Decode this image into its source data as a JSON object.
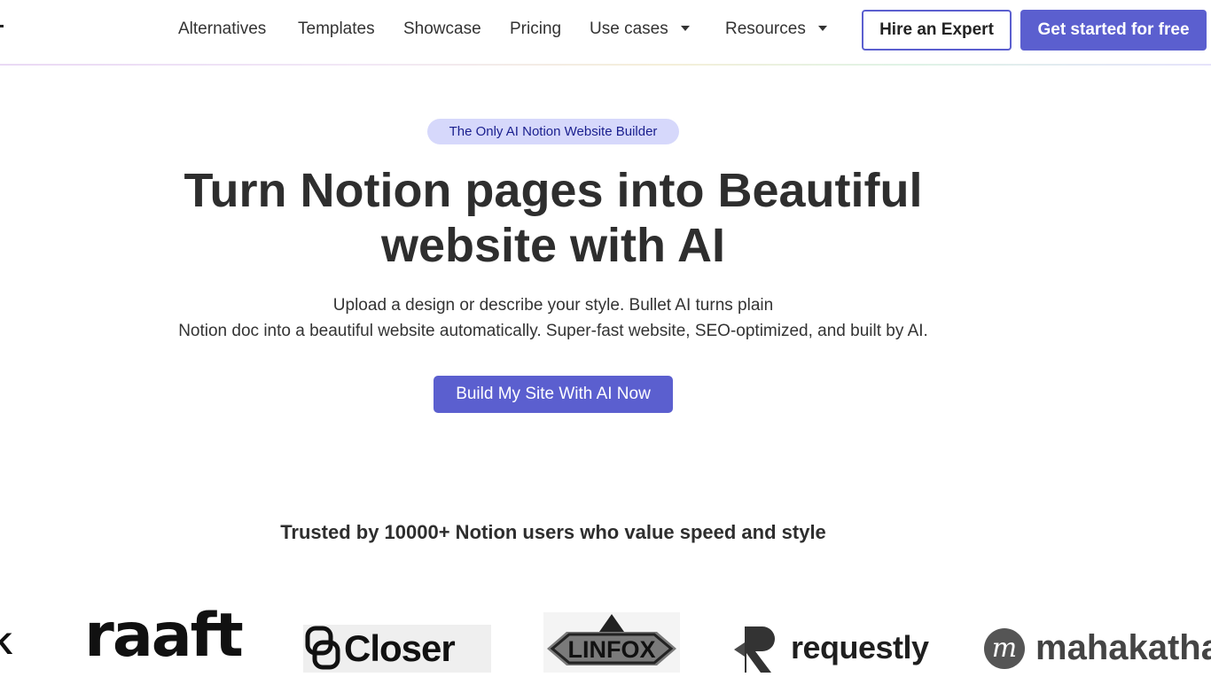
{
  "nav": {
    "links": [
      {
        "label": "Alternatives"
      },
      {
        "label": "Templates"
      },
      {
        "label": "Showcase"
      },
      {
        "label": "Pricing"
      },
      {
        "label": "Use cases",
        "has_dropdown": true
      },
      {
        "label": "Resources",
        "has_dropdown": true
      }
    ],
    "hire_label": "Hire an Expert",
    "get_started_label": "Get started for free"
  },
  "hero": {
    "badge": "The Only AI Notion Website Builder",
    "headline": "Turn Notion pages into Beautiful website with AI",
    "subtext_line1": "Upload a design or describe your style. Bullet AI turns plain",
    "subtext_line2": "Notion doc into a beautiful website automatically. Super-fast website, SEO-optimized, and built by AI.",
    "cta_label": "Build My Site With AI Now"
  },
  "trusted": {
    "text": "Trusted by 10000+ Notion users who value speed and style"
  },
  "logos": {
    "partial_left": "K",
    "raaft": "raaft",
    "closer": "Closer",
    "linfox": "LINFOX",
    "requestly": "requestly",
    "mahakatha": "mahakatha",
    "mahakatha_mark": "m"
  },
  "colors": {
    "accent": "#5b5fcf",
    "badge_bg": "#d6d8fb",
    "badge_text": "#1a1f8e",
    "text_dark": "#2e2e2e"
  }
}
